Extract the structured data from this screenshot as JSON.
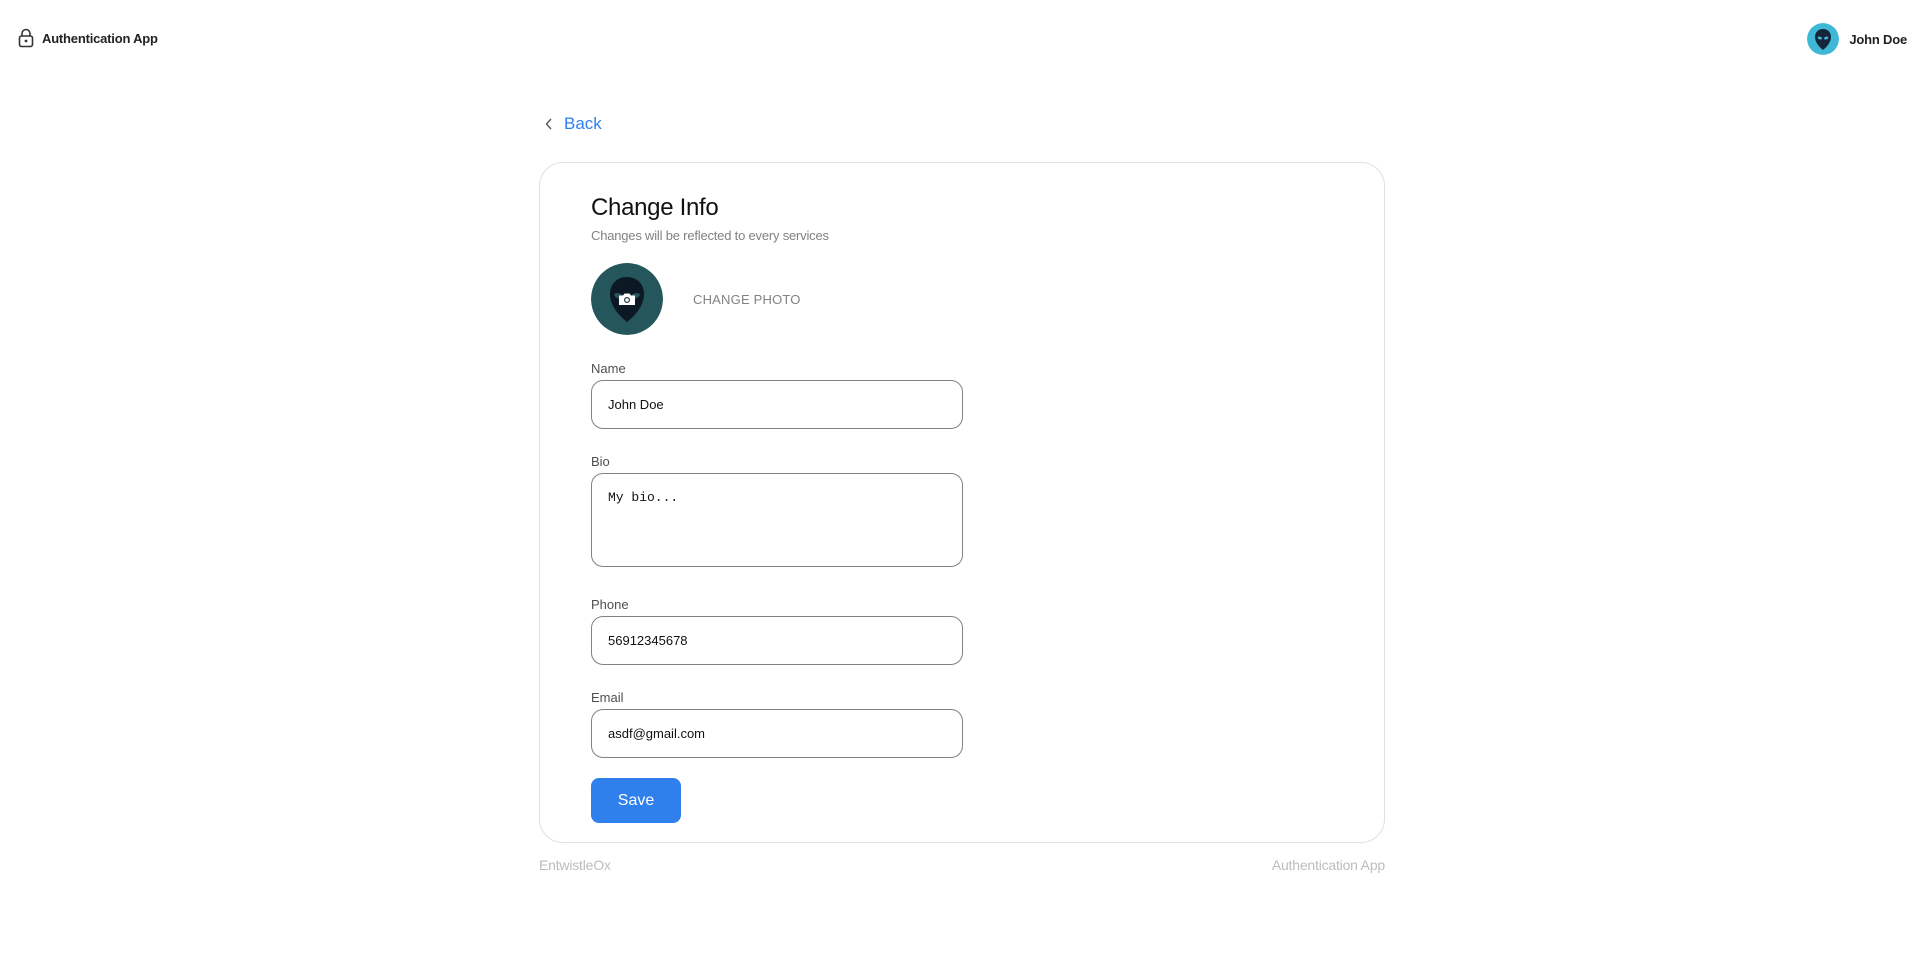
{
  "header": {
    "app_title": "Authentication App",
    "user_name": "John Doe"
  },
  "nav": {
    "back_label": "Back"
  },
  "card": {
    "title": "Change Info",
    "subtitle": "Changes will be reflected to every services",
    "change_photo_label": "CHANGE PHOTO"
  },
  "form": {
    "name": {
      "label": "Name",
      "value": "John Doe"
    },
    "bio": {
      "label": "Bio",
      "value": "My bio..."
    },
    "phone": {
      "label": "Phone",
      "value": "56912345678"
    },
    "email": {
      "label": "Email",
      "value": "asdf@gmail.com"
    },
    "save_label": "Save"
  },
  "footer": {
    "left": "EntwistleOx",
    "right": "Authentication App"
  },
  "colors": {
    "accent": "#2f80ed",
    "avatar_bg": "#2d6a6f",
    "avatar_small_bg": "#3fb8d8"
  },
  "icons": {
    "brand": "lock-icon",
    "back": "chevron-left-icon",
    "photo_overlay": "camera-icon"
  }
}
